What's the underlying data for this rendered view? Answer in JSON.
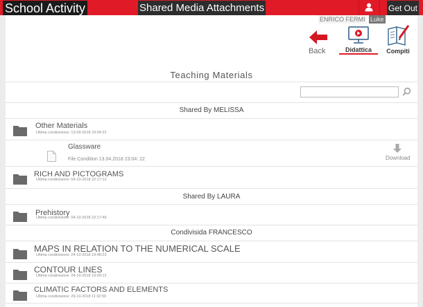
{
  "header": {
    "app_title": "School Activity",
    "page_heading": "Shared Media Attachments",
    "logout_label": "Get Out"
  },
  "user": {
    "name": "ENRICO FERMI",
    "tag": "Luke"
  },
  "toolbar": {
    "back_label": "Back",
    "tabs": [
      {
        "label": "Didattica",
        "icon": "video-lesson-icon",
        "active": true
      },
      {
        "label": "Compiti",
        "icon": "notebook-pencil-icon",
        "active": false
      }
    ]
  },
  "section_title": "Teaching Materials",
  "search": {
    "value": "",
    "placeholder": ""
  },
  "groups": [
    {
      "header": "Shared By MELISSA",
      "items": [
        {
          "type": "folder",
          "title": "Other Materials",
          "meta": "Ultima condivisione: 13-09-2018 23:04:22"
        },
        {
          "type": "file",
          "title": "Glassware",
          "meta": "File Condition 13.04.2018 23:04: 22",
          "action": "Download"
        },
        {
          "type": "folder",
          "title": "RICH AND PICTOGRAMS",
          "meta": "Ultima condivisione: 04-10-2018 22:17:12"
        }
      ]
    },
    {
      "header": "Shared By LAURA",
      "items": [
        {
          "type": "folder",
          "title": "Prehistory",
          "meta": "Ultima condivisione: 04-10-2018 22:17:49"
        }
      ]
    },
    {
      "header": "Condivisida FRANCESCO",
      "items": [
        {
          "type": "folder",
          "title": "MAPS IN RELATION TO THE NUMERICAL SCALE",
          "meta": "Ultima condivisione: 24-10-2018 19:48:23"
        },
        {
          "type": "folder",
          "title": "CONTOUR LINES",
          "meta": "Ultima condivisione: 24-10-2018 19:09:12"
        },
        {
          "type": "folder",
          "title": "CLIMATIC FACTORS AND ELEMENTS",
          "meta": "Ultima condivisione: 29-10-2018 11:32:50"
        }
      ]
    }
  ],
  "colors": {
    "accent": "#e01a26",
    "folder": "#6a6a6a"
  }
}
